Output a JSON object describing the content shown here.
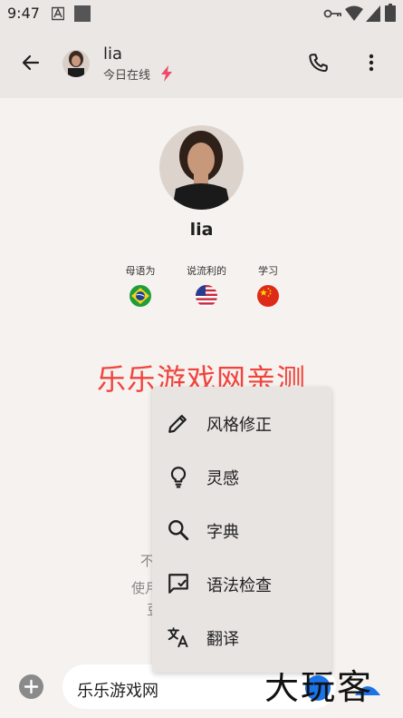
{
  "status_bar": {
    "time": "9:47"
  },
  "header": {
    "back_icon": "arrow-left-icon",
    "contact_name": "lia",
    "status_text": "今日在线",
    "status_icon": "lightning-icon",
    "call_icon": "phone-icon",
    "more_icon": "more-vert-icon"
  },
  "profile": {
    "name": "lia",
    "languages": [
      {
        "label": "母语为",
        "flag": "brazil"
      },
      {
        "label": "说流利的",
        "flag": "usa"
      },
      {
        "label": "学习",
        "flag": "china"
      }
    ]
  },
  "watermark": {
    "top_text": "乐乐游戏网亲测",
    "bottom_text": "大玩客"
  },
  "background_text": {
    "line1": "不",
    "line2": "使月",
    "line3": "豆"
  },
  "menu": {
    "items": [
      {
        "label": "风格修正",
        "icon": "pencil-icon"
      },
      {
        "label": "灵感",
        "icon": "lightbulb-icon"
      },
      {
        "label": "字典",
        "icon": "search-icon"
      },
      {
        "label": "语法检查",
        "icon": "rate-review-icon"
      },
      {
        "label": "翻译",
        "icon": "translate-icon"
      }
    ]
  },
  "composer": {
    "text": "乐乐游戏网",
    "add_icon": "add-circle-icon"
  },
  "colors": {
    "accent": "#ee4b6a",
    "watermark_red": "#f0443c",
    "send_blue": "#1a73e8"
  }
}
